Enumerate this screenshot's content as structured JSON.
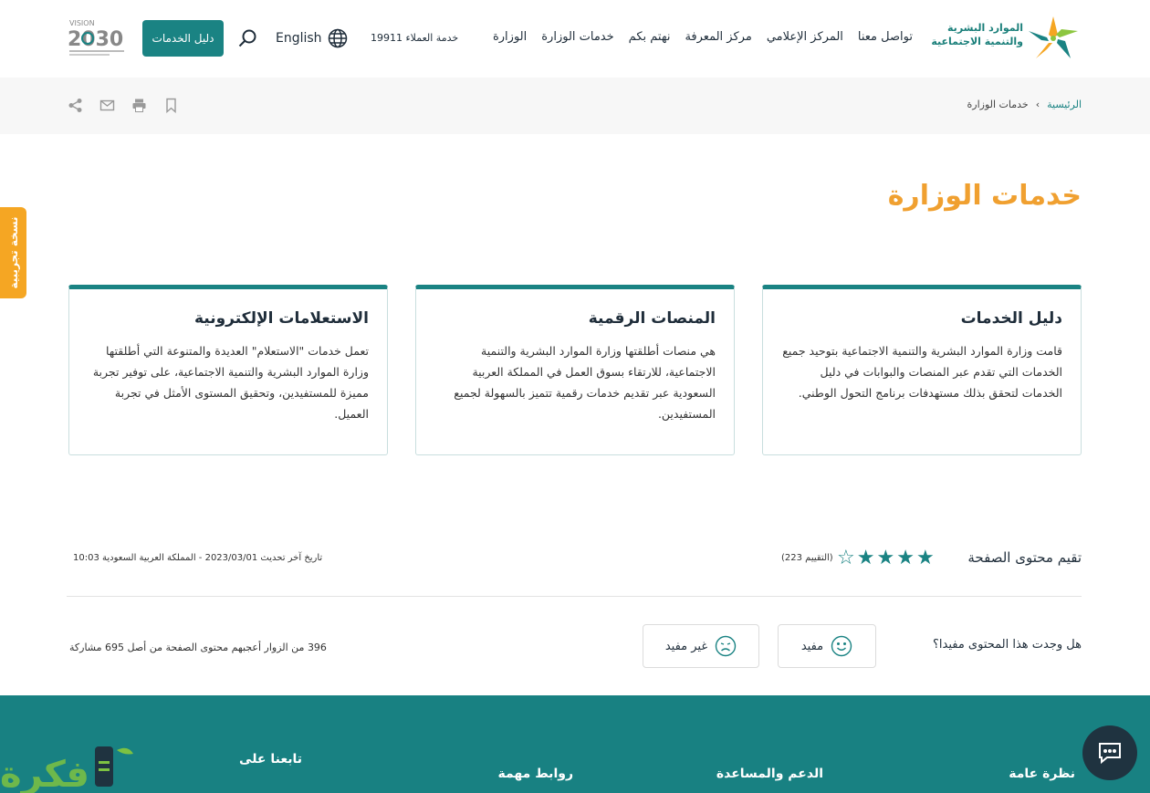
{
  "header": {
    "logo_line1": "الموارد البشرية",
    "logo_line2": "والتنمية الاجتماعية",
    "nav": [
      "الوزارة",
      "خدمات الوزارة",
      "نهتم بكم",
      "مركز المعرفة",
      "المركز الإعلامي",
      "تواصل معنا"
    ],
    "customer_service": "خدمة العملاء 19911",
    "language": "English",
    "guide_button": "دليل الخدمات",
    "vision_label": "VISION 2030"
  },
  "breadcrumb": {
    "home": "الرئيسية",
    "separator": "‹",
    "current": "خدمات الوزارة"
  },
  "page_title": "خدمات الوزارة",
  "cards": [
    {
      "title": "دليل الخدمات",
      "text": "قامت وزارة الموارد البشرية والتنمية الاجتماعية بتوحيد جميع الخدمات التي تقدم عبر المنصات والبوابات في دليل الخدمات لتحقق بذلك مستهدفات برنامج التحول الوطني."
    },
    {
      "title": "المنصات الرقمية",
      "text": "هي منصات أطلقتها وزارة الموارد البشرية والتنمية الاجتماعية، للارتقاء بسوق العمل في المملكة العربية السعودية عبر تقديم خدمات رقمية تتميز بالسهولة لجميع المستفيدين."
    },
    {
      "title": "الاستعلامات الإلكترونية",
      "text": "تعمل خدمات \"الاستعلام\" العديدة والمتنوعة التي أطلقتها وزارة الموارد البشرية والتنمية الاجتماعية، على توفير تجربة مميزة للمستفيدين، وتحقيق المستوى الأمثل في تجربة العميل."
    }
  ],
  "rating": {
    "label": "تقيم محتوى الصفحة",
    "stars_filled": 4,
    "stars_total": 5,
    "count_text": "(التقييم 223)",
    "updated_text": "تاريخ آخر تحديث  2023/03/01  - المملكة العربية السعودية  10:03"
  },
  "feedback": {
    "question": "هل وجدت هذا المحتوى مفيدا؟",
    "useful": "مفيد",
    "not_useful": "غير مفيد",
    "stats": "396 من الزوار أعجبهم محتوى الصفحة من أصل 695 مشاركة"
  },
  "footer": {
    "col1": "نظرة عامة",
    "col2": "الدعم والمساعدة",
    "col3": "روابط مهمة",
    "col4": "تابعنا على"
  },
  "beta_tab": "نسخة تجريبية",
  "colors": {
    "teal": "#1a8383",
    "orange": "#f0a030",
    "footer": "#188182"
  }
}
